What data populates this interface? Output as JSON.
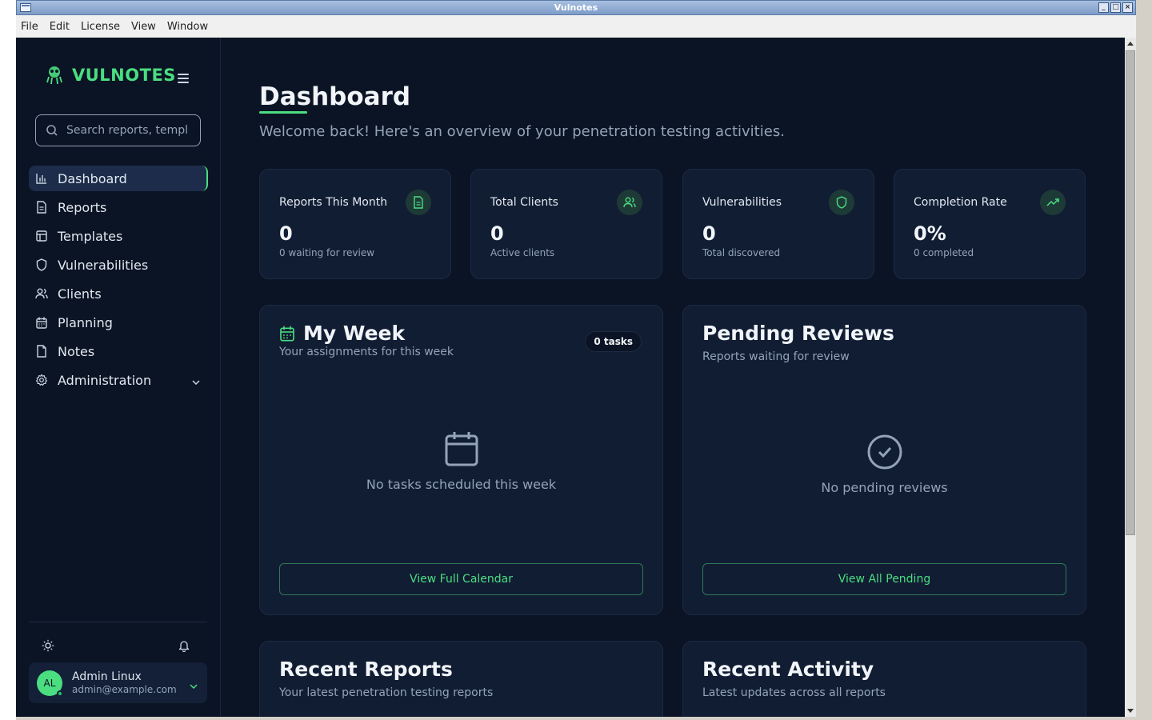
{
  "window": {
    "title": "Vulnotes"
  },
  "menubar": [
    "File",
    "Edit",
    "License",
    "View",
    "Window"
  ],
  "brand": {
    "name": "VULNOTES",
    "accent": "#4ade80"
  },
  "search": {
    "placeholder": "Search reports, templ"
  },
  "nav": [
    {
      "label": "Dashboard",
      "icon": "bar-chart-icon",
      "active": true
    },
    {
      "label": "Reports",
      "icon": "file-icon"
    },
    {
      "label": "Templates",
      "icon": "layout-icon"
    },
    {
      "label": "Vulnerabilities",
      "icon": "shield-icon"
    },
    {
      "label": "Clients",
      "icon": "users-icon"
    },
    {
      "label": "Planning",
      "icon": "calendar-icon"
    },
    {
      "label": "Notes",
      "icon": "note-icon"
    },
    {
      "label": "Administration",
      "icon": "gear-icon"
    }
  ],
  "user": {
    "initials": "AL",
    "name": "Admin Linux",
    "email": "admin@example.com"
  },
  "page": {
    "title": "Dashboard",
    "subtitle": "Welcome back! Here's an overview of your penetration testing activities."
  },
  "stats": [
    {
      "label": "Reports This Month",
      "value": "0",
      "desc": "0 waiting for review",
      "icon": "file-text-icon"
    },
    {
      "label": "Total Clients",
      "value": "0",
      "desc": "Active clients",
      "icon": "users-icon"
    },
    {
      "label": "Vulnerabilities",
      "value": "0",
      "desc": "Total discovered",
      "icon": "shield-icon"
    },
    {
      "label": "Completion Rate",
      "value": "0%",
      "desc": "0 completed",
      "icon": "trending-up-icon"
    }
  ],
  "my_week": {
    "title": "My Week",
    "subtitle": "Your assignments for this week",
    "badge": "0 tasks",
    "empty": "No tasks scheduled this week",
    "button": "View Full Calendar"
  },
  "pending": {
    "title": "Pending Reviews",
    "subtitle": "Reports waiting for review",
    "empty": "No pending reviews",
    "button": "View All Pending"
  },
  "recent_reports": {
    "title": "Recent Reports",
    "subtitle": "Your latest penetration testing reports"
  },
  "recent_activity": {
    "title": "Recent Activity",
    "subtitle": "Latest updates across all reports"
  }
}
